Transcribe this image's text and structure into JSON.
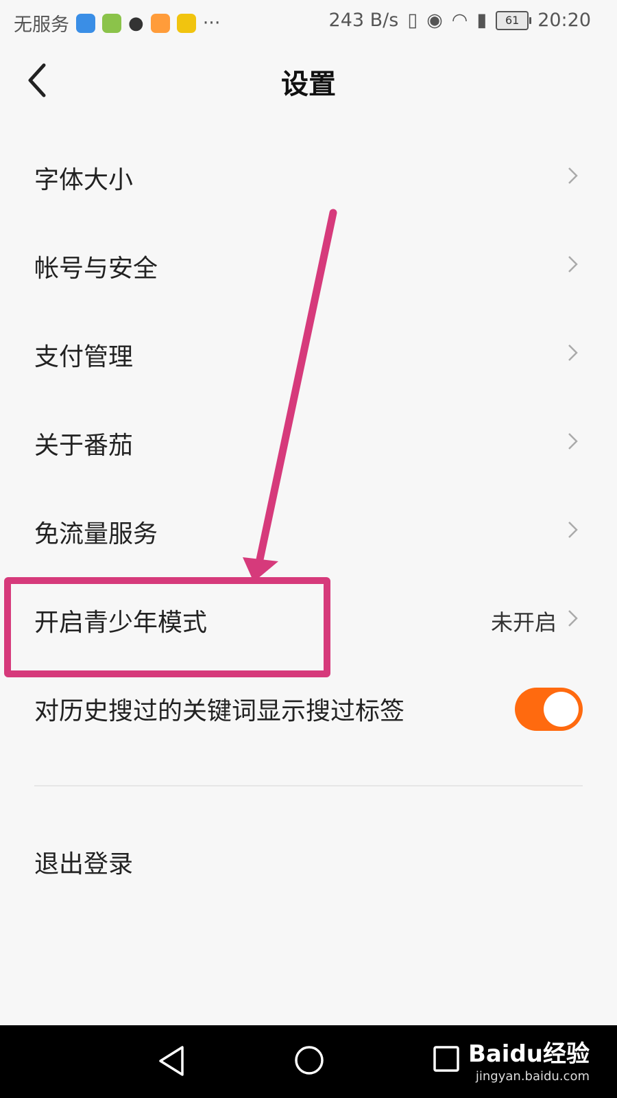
{
  "status_bar": {
    "carrier": "无服务",
    "more": "···",
    "net_speed": "243 B/s",
    "battery": "61",
    "time": "20:20"
  },
  "header": {
    "title": "设置"
  },
  "settings": {
    "font_size": "字体大小",
    "account_security": "帐号与安全",
    "payment": "支付管理",
    "about": "关于番茄",
    "free_data": "免流量服务",
    "youth_mode": "开启青少年模式",
    "youth_mode_status": "未开启",
    "search_tag": "对历史搜过的关键词显示搜过标签",
    "search_tag_enabled": true
  },
  "logout": "退出登录",
  "colors": {
    "toggle_on": "#ff6a0f",
    "annotation": "#d63a7b"
  },
  "watermark": {
    "logo": "Baidu经验",
    "url": "jingyan.baidu.com"
  }
}
